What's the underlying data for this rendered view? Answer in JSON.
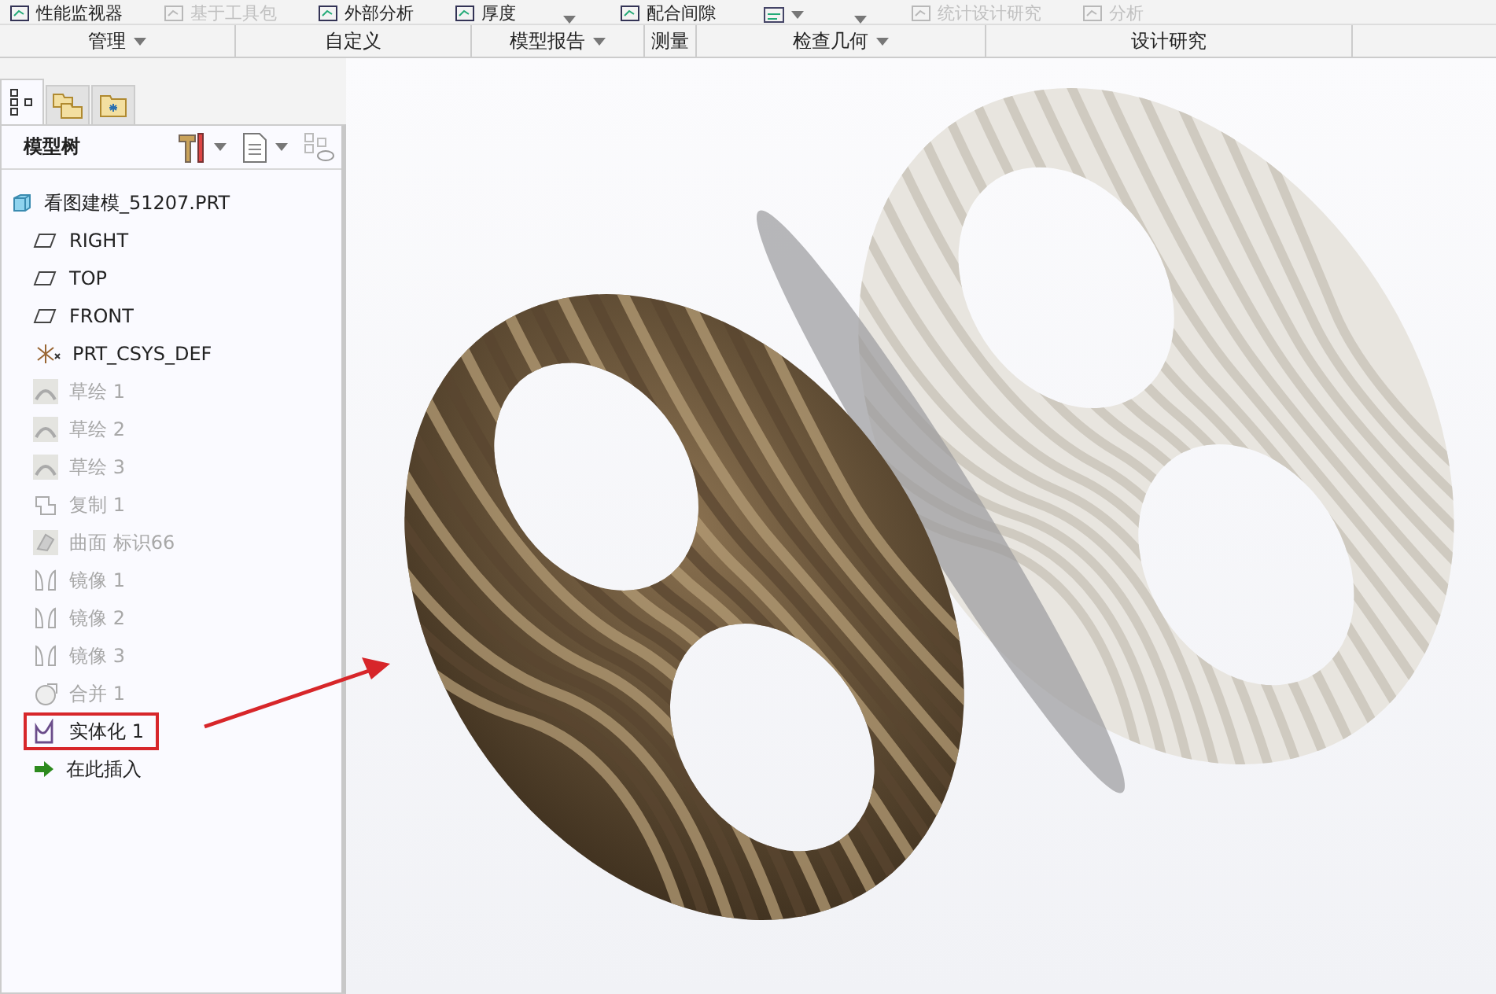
{
  "ribbon": {
    "tools": [
      {
        "label": "性能监视器",
        "disabled": false,
        "kind": "button"
      },
      {
        "label": "基于工具包",
        "disabled": true,
        "kind": "button"
      },
      {
        "label": "外部分析",
        "disabled": false,
        "kind": "button"
      },
      {
        "label": "厚度",
        "disabled": false,
        "kind": "button"
      },
      {
        "kind": "caret"
      },
      {
        "label": "配合间隙",
        "disabled": false,
        "kind": "button"
      },
      {
        "kind": "iconcaret"
      },
      {
        "kind": "caret"
      },
      {
        "label": "统计设计研究",
        "disabled": true,
        "kind": "button"
      },
      {
        "label": "分析",
        "disabled": true,
        "kind": "button"
      }
    ],
    "groups": [
      {
        "label": "管理",
        "dropdown": true
      },
      {
        "label": "自定义",
        "dropdown": false
      },
      {
        "label": "模型报告",
        "dropdown": true
      },
      {
        "label": "测量",
        "dropdown": false
      },
      {
        "label": "检查几何",
        "dropdown": true
      },
      {
        "label": "设计研究",
        "dropdown": false
      }
    ]
  },
  "tabs": [
    {
      "kind": "tree",
      "selected": true
    },
    {
      "kind": "folder",
      "selected": false
    },
    {
      "kind": "favorites",
      "selected": false
    }
  ],
  "model_tree": {
    "title": "模型树",
    "root": {
      "label": "看图建模_51207.PRT",
      "kind": "part",
      "children": [
        {
          "label": "RIGHT",
          "kind": "plane",
          "disabled": false,
          "highlighted": false
        },
        {
          "label": "TOP",
          "kind": "plane",
          "disabled": false,
          "highlighted": false
        },
        {
          "label": "FRONT",
          "kind": "plane",
          "disabled": false,
          "highlighted": false
        },
        {
          "label": "PRT_CSYS_DEF",
          "kind": "csys",
          "disabled": false,
          "highlighted": false
        },
        {
          "label": "草绘 1",
          "kind": "sketch",
          "disabled": true,
          "highlighted": false
        },
        {
          "label": "草绘 2",
          "kind": "sketch",
          "disabled": true,
          "highlighted": false
        },
        {
          "label": "草绘 3",
          "kind": "sketch",
          "disabled": true,
          "highlighted": false
        },
        {
          "label": "复制 1",
          "kind": "copy",
          "disabled": true,
          "highlighted": false
        },
        {
          "label": "曲面 标识66",
          "kind": "surface",
          "disabled": true,
          "highlighted": false
        },
        {
          "label": "镜像 1",
          "kind": "mirror",
          "disabled": true,
          "highlighted": false
        },
        {
          "label": "镜像 2",
          "kind": "mirror",
          "disabled": true,
          "highlighted": false
        },
        {
          "label": "镜像 3",
          "kind": "mirror",
          "disabled": true,
          "highlighted": false
        },
        {
          "label": "合并 1",
          "kind": "merge",
          "disabled": true,
          "highlighted": false
        },
        {
          "label": "实体化 1",
          "kind": "solidify",
          "disabled": false,
          "highlighted": true
        },
        {
          "label": "在此插入",
          "kind": "insert",
          "disabled": false,
          "highlighted": false
        }
      ]
    }
  }
}
